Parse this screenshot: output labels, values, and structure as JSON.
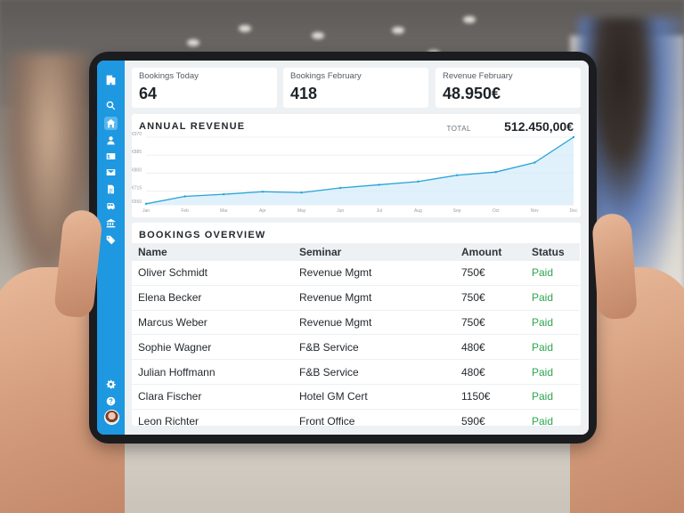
{
  "sidebar": {
    "icons": [
      "building-icon",
      "search-icon",
      "home-icon",
      "user-icon",
      "id-card-icon",
      "mail-icon",
      "document-icon",
      "bus-icon",
      "bank-icon",
      "tag-icon",
      "gear-icon",
      "help-icon"
    ],
    "active": "home-icon"
  },
  "stats": [
    {
      "label": "Bookings Today",
      "value": "64"
    },
    {
      "label": "Bookings February",
      "value": "418"
    },
    {
      "label": "Revenue February",
      "value": "48.950€"
    }
  ],
  "annual_revenue": {
    "title": "ANNUAL REVENUE",
    "total_label": "TOTAL",
    "total_value": "512.450,00€"
  },
  "chart_data": {
    "type": "area",
    "title": "ANNUAL REVENUE",
    "x": [
      "Jan",
      "Feb",
      "Mar",
      "Apr",
      "May",
      "Jun",
      "Jul",
      "Aug",
      "Sep",
      "Oct",
      "Nov",
      "Dec"
    ],
    "y_ticks": [
      "€650",
      "€715",
      "€800",
      "€885",
      "€970"
    ],
    "ylim": [
      650,
      970
    ],
    "values": [
      655,
      690,
      700,
      712,
      708,
      730,
      745,
      760,
      790,
      805,
      850,
      970
    ],
    "grid": true,
    "colors": {
      "line": "#29a3d8",
      "fill": "#d6ecfa"
    }
  },
  "bookings": {
    "title": "BOOKINGS OVERVIEW",
    "columns": [
      "Name",
      "Seminar",
      "Amount",
      "Status"
    ],
    "rows": [
      [
        "Oliver Schmidt",
        "Revenue Mgmt",
        "750€",
        "Paid"
      ],
      [
        "Elena Becker",
        "Revenue Mgmt",
        "750€",
        "Paid"
      ],
      [
        "Marcus Weber",
        "Revenue Mgmt",
        "750€",
        "Paid"
      ],
      [
        "Sophie Wagner",
        "F&B Service",
        "480€",
        "Paid"
      ],
      [
        "Julian Hoffmann",
        "F&B Service",
        "480€",
        "Paid"
      ],
      [
        "Clara Fischer",
        "Hotel GM Cert",
        "1150€",
        "Paid"
      ],
      [
        "Leon Richter",
        "Front Office",
        "590€",
        "Paid"
      ]
    ]
  },
  "colors": {
    "accent": "#1e98e0",
    "paid": "#2ea44f"
  }
}
